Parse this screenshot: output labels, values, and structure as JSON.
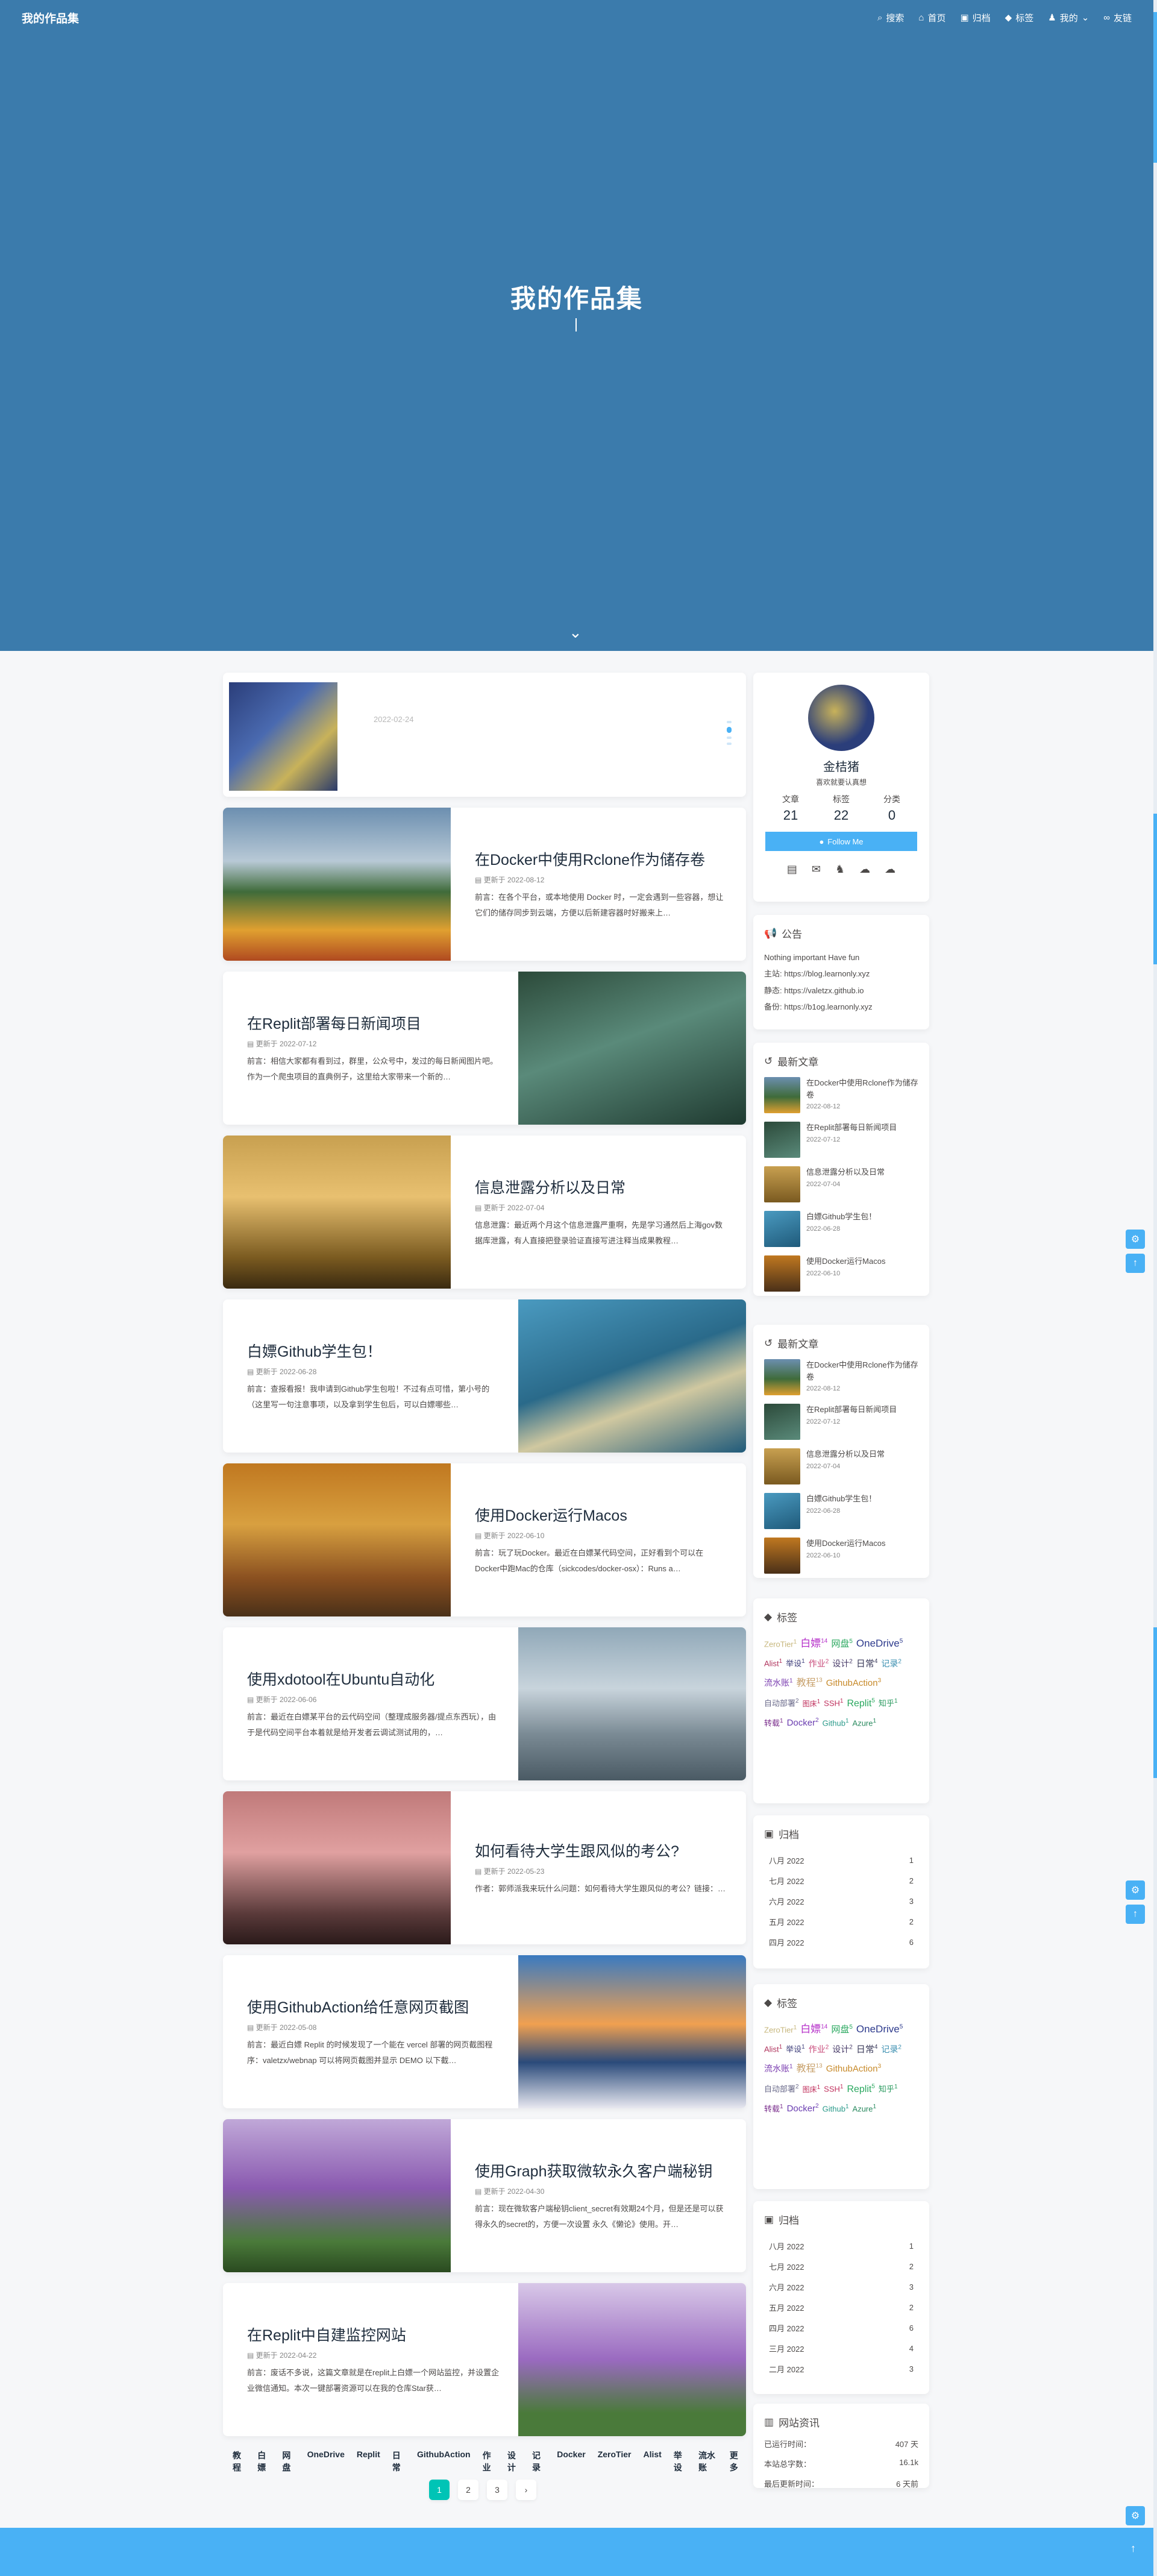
{
  "nav": {
    "brand": "我的作品集",
    "menu": [
      "搜索",
      "首页",
      "归档",
      "标签",
      "我的",
      "友链"
    ]
  },
  "hero": {
    "title": "我的作品集"
  },
  "posts": [
    {
      "title": "",
      "date": "2022-02-24",
      "excerpt": ""
    },
    {
      "title": "在Docker中使用Rclone作为储存卷",
      "date": "更新于 2022-08-12",
      "excerpt": "前言：在各个平台，或本地使用 Docker 时，一定会遇到一些容器，想让它们的储存同步到云端，方便以后新建容器时好搬来上…"
    },
    {
      "title": "在Replit部署每日新闻项目",
      "date": "更新于 2022-07-12",
      "excerpt": "前言：相信大家都有看到过，群里，公众号中，发过的每日新闻图片吧。作为一个爬虫项目的直典例子，这里给大家带来一个新的…"
    },
    {
      "title": "信息泄露分析以及日常",
      "date": "更新于 2022-07-04",
      "excerpt": "信息泄露：最近两个月这个信息泄露严重啊，先是学习通然后上海gov数据库泄露，有人直接把登录验证直接写进注释当成果教程…"
    },
    {
      "title": "白嫖Github学生包！",
      "date": "更新于 2022-06-28",
      "excerpt": "前言：查报看报！我申请到Github学生包啦！不过有点可惜，第小号的（这里写一句注意事项，以及拿到学生包后，可以白嫖哪些…"
    },
    {
      "title": "使用Docker运行Macos",
      "date": "更新于 2022-06-10",
      "excerpt": "前言：玩了玩Docker。最近在白嫖某代码空间，正好看到个可以在Docker中跑Mac的仓库（sickcodes/docker-osx）：Runs a…"
    },
    {
      "title": "使用xdotool在Ubuntu自动化",
      "date": "更新于 2022-06-06",
      "excerpt": "前言：最近在白嫖某平台的云代码空间（整理成服务器/提点东西玩），由于是代码空间平台本着就是给开发者云调试测试用的，…"
    },
    {
      "title": "如何看待大学生跟风似的考公?",
      "date": "更新于 2022-05-23",
      "excerpt": "作者：郭师派我来玩什么问题：如何看待大学生跟风似的考公？链接：…"
    },
    {
      "title": "使用GithubAction给任意网页截图",
      "date": "更新于 2022-05-08",
      "excerpt": "前言：最近白嫖 Replit 的时候发现了一个能在 vercel 部署的网页截图程序：valetzx/webnap 可以将网页截图并显示 DEMO 以下截…"
    },
    {
      "title": "使用Graph获取微软永久客户端秘钥",
      "date": "更新于 2022-04-30",
      "excerpt": "前言：现在微软客户端秘钥client_secret有效期24个月，但是还是可以获得永久的secret的，方便一次设置 永久《懒论》使用。开…"
    },
    {
      "title": "在Replit中自建监控网站",
      "date": "更新于 2022-04-22",
      "excerpt": "前言：废话不多说，这篇文章就是在replit上白嫖一个网站监控，并设置企业微信通知。本次一键部署资源可以在我的仓库Star获…"
    }
  ],
  "profile": {
    "name": "金桔猪",
    "desc": "喜欢就要认真想",
    "stats": [
      {
        "label": "文章",
        "value": "21"
      },
      {
        "label": "标签",
        "value": "22"
      },
      {
        "label": "分类",
        "value": "0"
      }
    ],
    "follow": "Follow Me",
    "social_icons": [
      "calendar-icon",
      "mail-icon",
      "qq-icon",
      "cloud-upload-icon",
      "cloud-download-icon"
    ]
  },
  "announcement": {
    "title": "公告",
    "lines": [
      "Nothing important Have fun",
      "主站: https://blog.learnonly.xyz",
      "静态: https://valetzx.github.io",
      "备份: https://b1og.learnonly.xyz"
    ]
  },
  "recent": {
    "title": "最新文章",
    "items": [
      {
        "title": "在Docker中使用Rclone作为储存卷",
        "date": "2022-08-12"
      },
      {
        "title": "在Replit部署每日新闻项目",
        "date": "2022-07-12"
      },
      {
        "title": "信息泄露分析以及日常",
        "date": "2022-07-04"
      },
      {
        "title": "白嫖Github学生包！",
        "date": "2022-06-28"
      },
      {
        "title": "使用Docker运行Macos",
        "date": "2022-06-10"
      }
    ]
  },
  "tags": {
    "title": "标签",
    "items": [
      {
        "name": "ZeroTier",
        "count": "1",
        "color": "#c7b77d"
      },
      {
        "name": "白嫖",
        "count": "14",
        "color": "#b42dc8"
      },
      {
        "name": "网盘",
        "count": "5",
        "color": "#2aa85f"
      },
      {
        "name": "OneDrive",
        "count": "5",
        "color": "#2d3a8c"
      },
      {
        "name": "Alist",
        "count": "1",
        "color": "#b0345d"
      },
      {
        "name": "举设",
        "count": "1",
        "color": "#3d3d7a"
      },
      {
        "name": "作业",
        "count": "2",
        "color": "#c84a7a"
      },
      {
        "name": "设计",
        "count": "2",
        "color": "#4a3d6a"
      },
      {
        "name": "日常",
        "count": "4",
        "color": "#3a3a5a"
      },
      {
        "name": "记录",
        "count": "2",
        "color": "#3b8fb0"
      },
      {
        "name": "流水账",
        "count": "1",
        "color": "#7a3db0"
      },
      {
        "name": "教程",
        "count": "13",
        "color": "#c7a06a"
      },
      {
        "name": "GithubAction",
        "count": "3",
        "color": "#c78a2a"
      },
      {
        "name": "自动部署",
        "count": "2",
        "color": "#6a6a8a"
      },
      {
        "name": "图床",
        "count": "1",
        "color": "#c0305d"
      },
      {
        "name": "SSH",
        "count": "1",
        "color": "#c0305d"
      },
      {
        "name": "Replit",
        "count": "5",
        "color": "#2aa85f"
      },
      {
        "name": "知乎",
        "count": "1",
        "color": "#2a9a5f"
      },
      {
        "name": "转载",
        "count": "1",
        "color": "#7a2d8c"
      },
      {
        "name": "Docker",
        "count": "2",
        "color": "#6a3db0"
      },
      {
        "name": "Github",
        "count": "1",
        "color": "#2a9a8a"
      },
      {
        "name": "Azure",
        "count": "1",
        "color": "#2a8a5f"
      }
    ]
  },
  "archive": {
    "title": "归档",
    "items": [
      {
        "month": "八月 2022",
        "count": "1"
      },
      {
        "month": "七月 2022",
        "count": "2"
      },
      {
        "month": "六月 2022",
        "count": "3"
      },
      {
        "month": "五月 2022",
        "count": "2"
      },
      {
        "month": "四月 2022",
        "count": "6"
      },
      {
        "month": "三月 2022",
        "count": "4"
      },
      {
        "month": "二月 2022",
        "count": "3"
      }
    ]
  },
  "siteinfo": {
    "title": "网站资讯",
    "rows": [
      {
        "k": "已运行时间：",
        "v": "407 天"
      },
      {
        "k": "本站总字数：",
        "v": "16.1k"
      },
      {
        "k": "最后更新时间：",
        "v": "6 天前"
      }
    ]
  },
  "tagbar": [
    "教程",
    "白嫖",
    "网盘",
    "OneDrive",
    "Replit",
    "日常",
    "GithubAction",
    "作业",
    "设计",
    "记录",
    "Docker",
    "ZeroTier",
    "Alist",
    "举设",
    "流水账",
    "更多"
  ],
  "pager": [
    "1",
    "2",
    "3",
    "›"
  ],
  "colors": {
    "hero": "#3b7bac",
    "accent": "#49b1f5",
    "pager_current": "#00c4b6"
  }
}
